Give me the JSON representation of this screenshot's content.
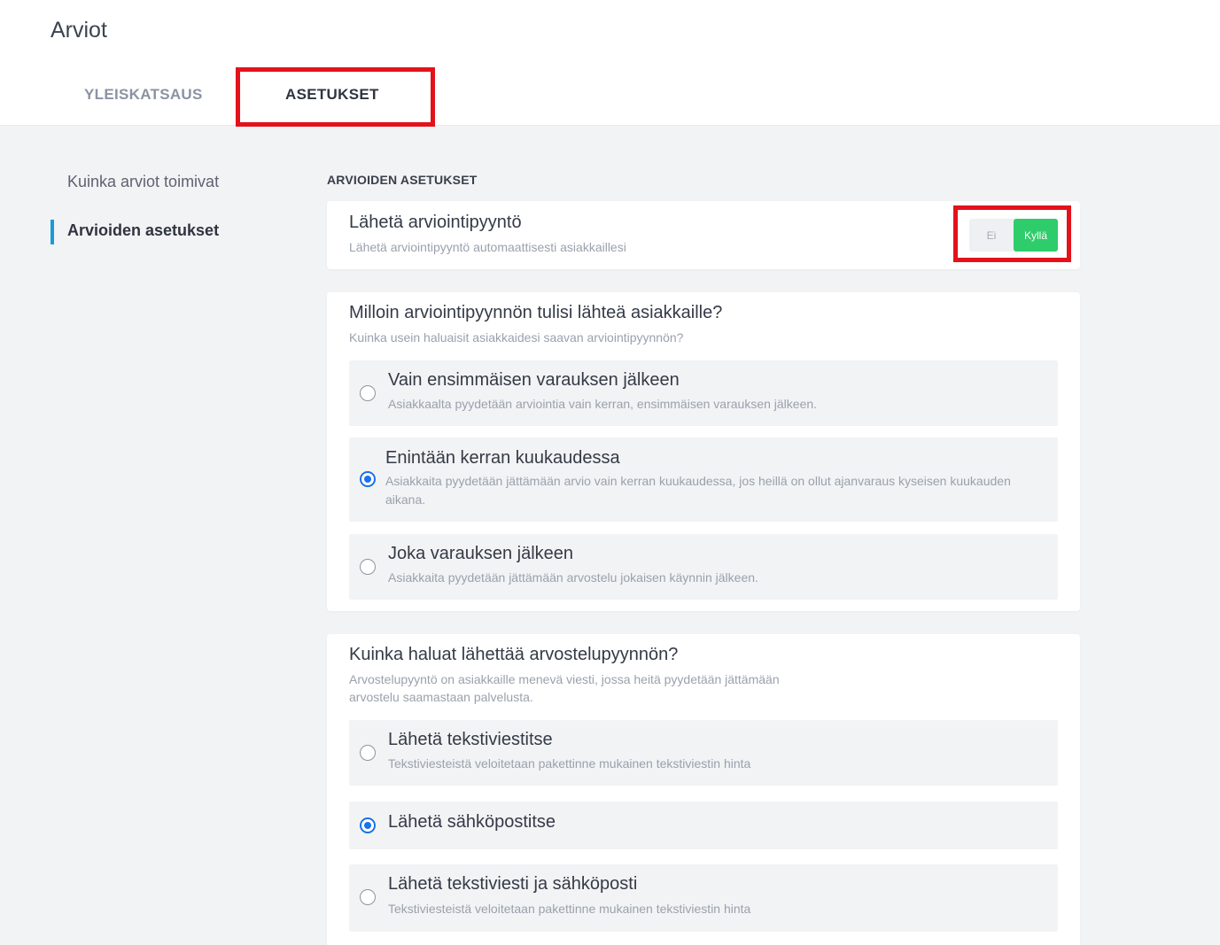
{
  "page": {
    "title": "Arviot"
  },
  "tabs": [
    {
      "label": "YLEISKATSAUS",
      "active": false
    },
    {
      "label": "ASETUKSET",
      "active": true
    }
  ],
  "sidenav": [
    {
      "label": "Kuinka arviot toimivat",
      "active": false
    },
    {
      "label": "Arvioiden asetukset",
      "active": true
    }
  ],
  "section_heading": "ARVIOIDEN ASETUKSET",
  "send_request": {
    "title": "Lähetä arviointipyyntö",
    "subtitle": "Lähetä arviointipyyntö automaattisesti asiakkaillesi",
    "toggle": {
      "off_label": "Ei",
      "on_label": "Kyllä",
      "value": "Kyllä"
    }
  },
  "timing": {
    "title": "Milloin arviointipyynnön tulisi lähteä asiakkaille?",
    "subtitle": "Kuinka usein haluaisit asiakkaidesi saavan arviointipyynnön?",
    "options": [
      {
        "title": "Vain ensimmäisen varauksen jälkeen",
        "description": "Asiakkaalta pyydetään arviointia vain kerran, ensimmäisen varauksen jälkeen.",
        "selected": false
      },
      {
        "title": "Enintään kerran kuukaudessa",
        "description": "Asiakkaita pyydetään jättämään arvio vain kerran kuukaudessa, jos heillä on ollut ajanvaraus kyseisen kuukauden aikana.",
        "selected": true
      },
      {
        "title": "Joka varauksen jälkeen",
        "description": "Asiakkaita pyydetään jättämään arvostelu jokaisen käynnin jälkeen.",
        "selected": false
      }
    ]
  },
  "method": {
    "title": "Kuinka haluat lähettää arvostelupyynnön?",
    "subtitle": "Arvostelupyyntö on asiakkaille menevä viesti, jossa heitä pyydetään jättämään arvostelu saamastaan palvelusta.",
    "options": [
      {
        "title": "Lähetä tekstiviestitse",
        "description": "Tekstiviesteistä veloitetaan pakettinne mukainen tekstiviestin hinta",
        "selected": false
      },
      {
        "title": "Lähetä sähköpostitse",
        "description": "",
        "selected": true
      },
      {
        "title": "Lähetä tekstiviesti ja sähköposti",
        "description": "Tekstiviesteistä veloitetaan pakettinne mukainen tekstiviestin hinta",
        "selected": false
      }
    ]
  },
  "highlight_color": "#e3121b",
  "accent_color": "#2fcc6b",
  "radio_color": "#1a73e8"
}
